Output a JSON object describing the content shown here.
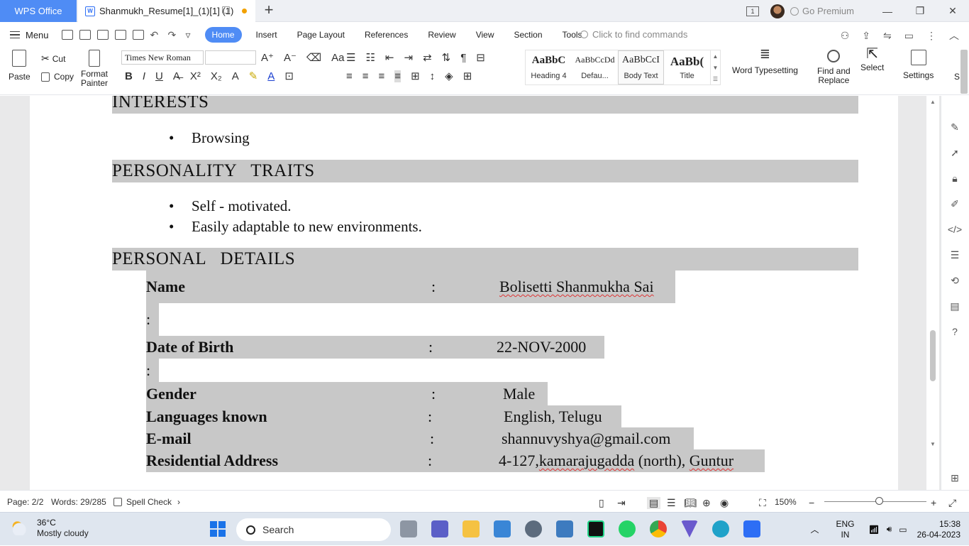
{
  "titlebar": {
    "app_tab": "WPS Office",
    "doc_tab": "Shanmukh_Resume[1]_(1)[1] (1)",
    "premium": "Go Premium",
    "box_label": "1"
  },
  "menu": {
    "menu_label": "Menu",
    "tabs": [
      "Home",
      "Insert",
      "Page Layout",
      "References",
      "Review",
      "View",
      "Section",
      "Tools"
    ],
    "find_placeholder": "Click to find commands"
  },
  "ribbon": {
    "paste": "Paste",
    "cut": "Cut",
    "copy": "Copy",
    "format_painter_1": "Format",
    "format_painter_2": "Painter",
    "font_name": "Times New Roman",
    "font_size": "",
    "styles": [
      {
        "sample": "AaBbC",
        "name": "Heading 4"
      },
      {
        "sample": "AaBbCcDd",
        "name": "Defau..."
      },
      {
        "sample": "AaBbCcI",
        "name": "Body Text"
      },
      {
        "sample": "AaBb(",
        "name": "Title"
      }
    ],
    "word_typesetting": "Word Typesetting",
    "find_replace_1": "Find and",
    "find_replace_2": "Replace",
    "select": "Select",
    "settings": "Settings",
    "cut_off": "S"
  },
  "document": {
    "sections": {
      "interests": "INTERESTS",
      "personality": "PERSONALITY   TRAITS",
      "personal": "PERSONAL   DETAILS"
    },
    "interests": [
      "Browsing"
    ],
    "traits": [
      "Self - motivated.",
      "Easily adaptable to new environments."
    ],
    "bullet_char": "•",
    "details": {
      "name_label": "Name",
      "name_value": "Bolisetti Shanmukha Sai",
      "dob_label": "Date of Birth",
      "dob_value": "22-NOV-2000",
      "gender_label": "Gender",
      "gender_value": "Male",
      "lang_label": "Languages known",
      "lang_value": "English, Telugu",
      "email_label": "E-mail",
      "email_value": "shannuvyshya@gmail.com",
      "addr_label": "Residential Address",
      "addr_value_1": "4-127,",
      "addr_value_2": "kamarajugadda",
      "addr_value_3": " (north), ",
      "addr_value_4": "Guntur",
      "colon": ":"
    }
  },
  "status": {
    "page": "Page: 2/2",
    "words": "Words: 29/285",
    "spell": "Spell Check",
    "zoom": "150%"
  },
  "taskbar": {
    "temp": "36°C",
    "weather": "Mostly cloudy",
    "search": "Search",
    "lang_1": "ENG",
    "lang_2": "IN",
    "time": "15:38",
    "date": "26-04-2023"
  },
  "colors": {
    "accent": "#4f8cf5",
    "highlight": "#c8c8c8"
  }
}
